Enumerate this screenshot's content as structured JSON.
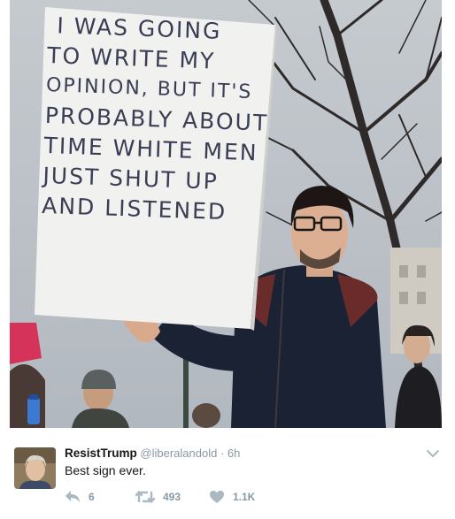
{
  "photo": {
    "sign_lines": [
      "I WAS GOING",
      "TO WRITE MY",
      "OPINION, BUT IT'S",
      "PROBABLY ABOUT",
      "TIME WHITE MEN",
      "JUST SHUT UP",
      "AND LISTENED"
    ]
  },
  "tweet": {
    "display_name": "ResistTrump",
    "handle": "@liberalandold",
    "separator": "·",
    "time": "6h",
    "text": "Best sign ever.",
    "actions": {
      "reply_count": "6",
      "retweet_count": "493",
      "like_count": "1.1K"
    }
  },
  "colors": {
    "action_gray": "#aab8c2",
    "text_primary": "#14171a",
    "text_secondary": "#8899a6"
  },
  "icons": [
    "reply-icon",
    "retweet-icon",
    "heart-icon",
    "chevron-down-icon"
  ]
}
